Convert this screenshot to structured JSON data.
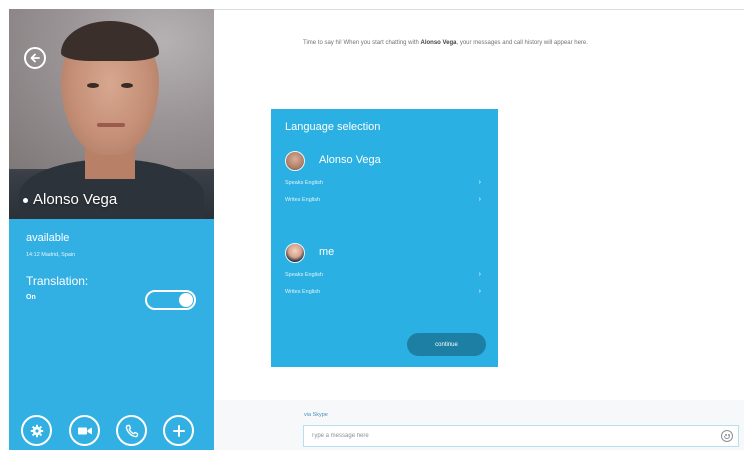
{
  "contact": {
    "name": "Alonso Vega",
    "status": "available",
    "location": "14:12 Madrid, Spain",
    "translation_label": "Translation:",
    "translation_value": "On",
    "translation_enabled": true
  },
  "icons": {
    "back": "back-arrow-icon",
    "settings": "gear-icon",
    "video": "video-camera-icon",
    "call": "phone-icon",
    "add": "plus-icon",
    "emoji": "smiley-icon"
  },
  "conversation": {
    "intro_prefix": "Time to say hi! When you start chatting with ",
    "intro_name": "Alonso Vega",
    "intro_suffix": ", your messages and call history will appear here."
  },
  "language_selection": {
    "title": "Language selection",
    "people": [
      {
        "name": "Alonso Vega",
        "speaks": "Speaks English",
        "writes": "Writes English"
      },
      {
        "name": "me",
        "speaks": "Speaks English",
        "writes": "Writes English"
      }
    ],
    "continue_label": "continue"
  },
  "compose": {
    "service_label": "via Skype",
    "placeholder": "Type a message here"
  },
  "colors": {
    "accent": "#33b0e3",
    "card": "#2ab0e2",
    "button_dark": "#1d7fa3"
  }
}
